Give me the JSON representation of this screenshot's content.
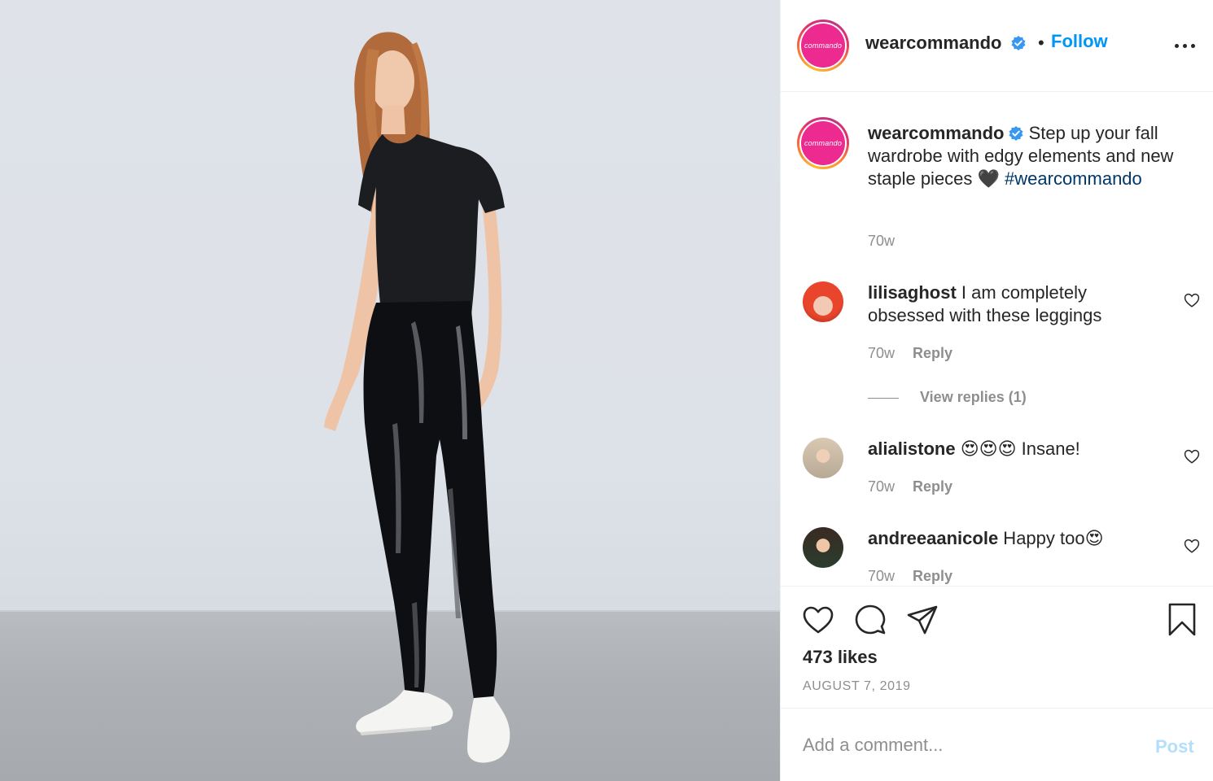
{
  "post": {
    "image_alt": "model in black tee and glossy black leggings with white sneakers",
    "colors": {
      "accent": "#0095f6",
      "hashtag": "#00376b",
      "muted": "#8e8e8e",
      "brand_pink": "#ec2a8f"
    }
  },
  "header": {
    "avatar_text": "commando",
    "username": "wearcommando",
    "verified_icon": "verified-badge-icon",
    "separator": "•",
    "follow_label": "Follow",
    "more_icon": "more-options-icon"
  },
  "caption": {
    "avatar_text": "commando",
    "username": "wearcommando",
    "text": " Step up your fall wardrobe with edgy elements and new staple pieces 🖤 ",
    "hashtag": "#wearcommando",
    "time": "70w"
  },
  "comments": [
    {
      "username": "lilisaghost",
      "text": " I am completely obsessed with these leggings",
      "time": "70w",
      "reply_label": "Reply",
      "like_icon": "heart-outline-icon"
    },
    {
      "username": "alialistone",
      "text": " 😍😍😍 Insane!",
      "time": "70w",
      "reply_label": "Reply",
      "like_icon": "heart-outline-icon"
    },
    {
      "username": "andreeaanicole",
      "text": " Happy too😍",
      "time": "70w",
      "reply_label": "Reply",
      "like_icon": "heart-outline-icon"
    }
  ],
  "view_replies": "View replies (1)",
  "actions": {
    "like_icon": "heart-icon",
    "comment_icon": "comment-icon",
    "share_icon": "paper-plane-icon",
    "save_icon": "bookmark-icon"
  },
  "likes": "473 likes",
  "date": "AUGUST 7, 2019",
  "add_comment": {
    "placeholder": "Add a comment...",
    "post_label": "Post"
  }
}
